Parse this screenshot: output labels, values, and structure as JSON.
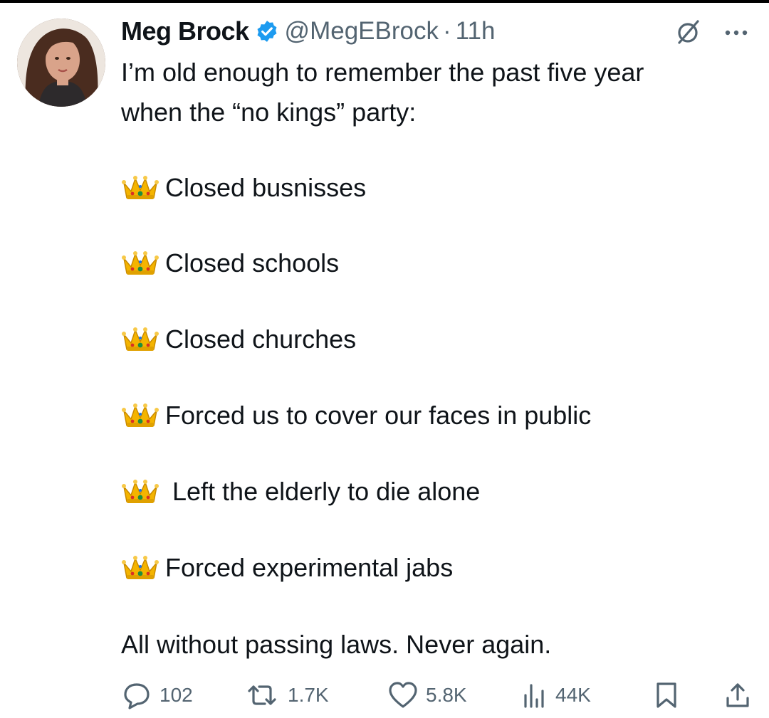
{
  "post": {
    "author": {
      "name": "Meg Brock",
      "handle": "@MegEBrock",
      "time": "11h",
      "separator": "·",
      "verified": true
    },
    "intro_line1": "I’m old enough to remember the past five year",
    "intro_line2": "when the “no kings” party:",
    "items": [
      {
        "icon": "crown-icon",
        "text": "Closed busnisses"
      },
      {
        "icon": "crown-icon",
        "text": "Closed schools"
      },
      {
        "icon": "crown-icon",
        "text": "Closed churches"
      },
      {
        "icon": "crown-icon",
        "text": "Forced us to cover our faces in public"
      },
      {
        "icon": "crown-icon",
        "text": " Left the elderly to die alone"
      },
      {
        "icon": "crown-icon",
        "text": "Forced experimental jabs"
      }
    ],
    "closing": "All without passing laws. Never again."
  },
  "actions": {
    "replies": "102",
    "reposts": "1.7K",
    "likes": "5.8K",
    "views": "44K"
  },
  "colors": {
    "text": "#0f1419",
    "muted": "#536471",
    "verified_blue": "#1d9bf0",
    "crown_gold": "#f4b400"
  }
}
